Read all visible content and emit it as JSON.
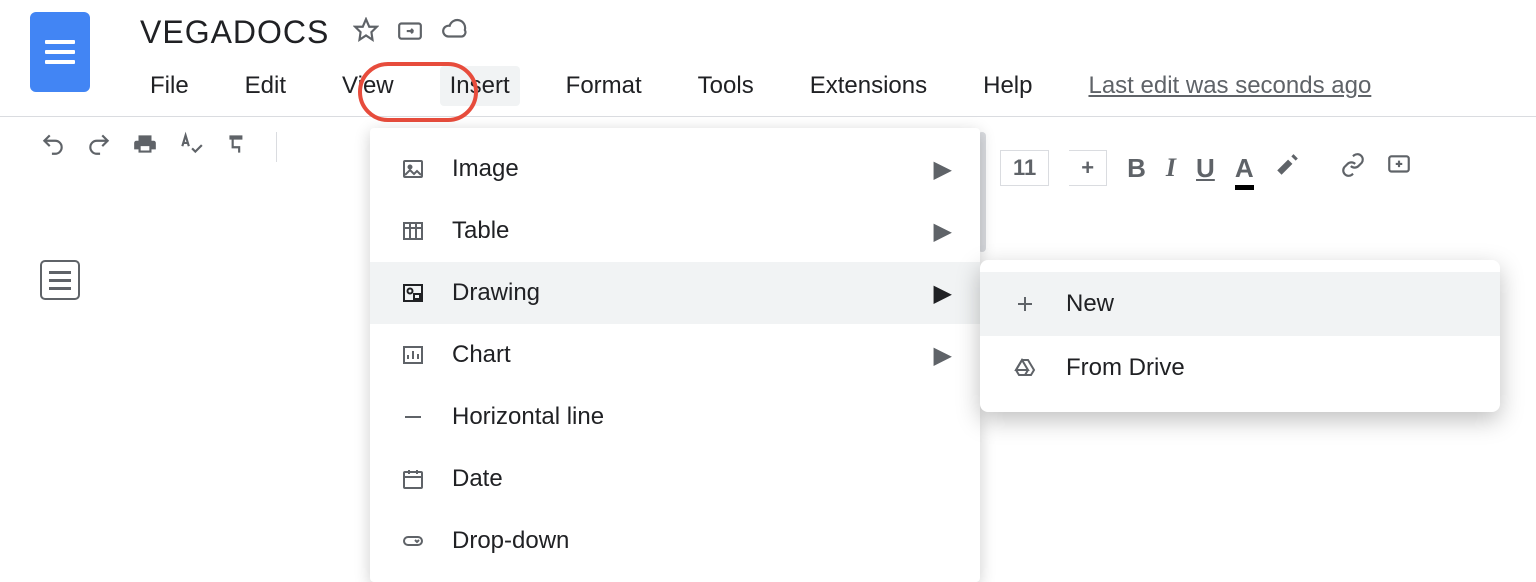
{
  "doc": {
    "title": "VEGADOCS"
  },
  "menubar": {
    "file": "File",
    "edit": "Edit",
    "view": "View",
    "insert": "Insert",
    "format": "Format",
    "tools": "Tools",
    "extensions": "Extensions",
    "help": "Help"
  },
  "last_edit": "Last edit was seconds ago",
  "toolbar": {
    "font_size": "11",
    "plus": "+"
  },
  "insert_menu": {
    "image": "Image",
    "table": "Table",
    "drawing": "Drawing",
    "chart": "Chart",
    "hline": "Horizontal line",
    "date": "Date",
    "dropdown": "Drop-down"
  },
  "drawing_submenu": {
    "new": "New",
    "from_drive": "From Drive"
  }
}
